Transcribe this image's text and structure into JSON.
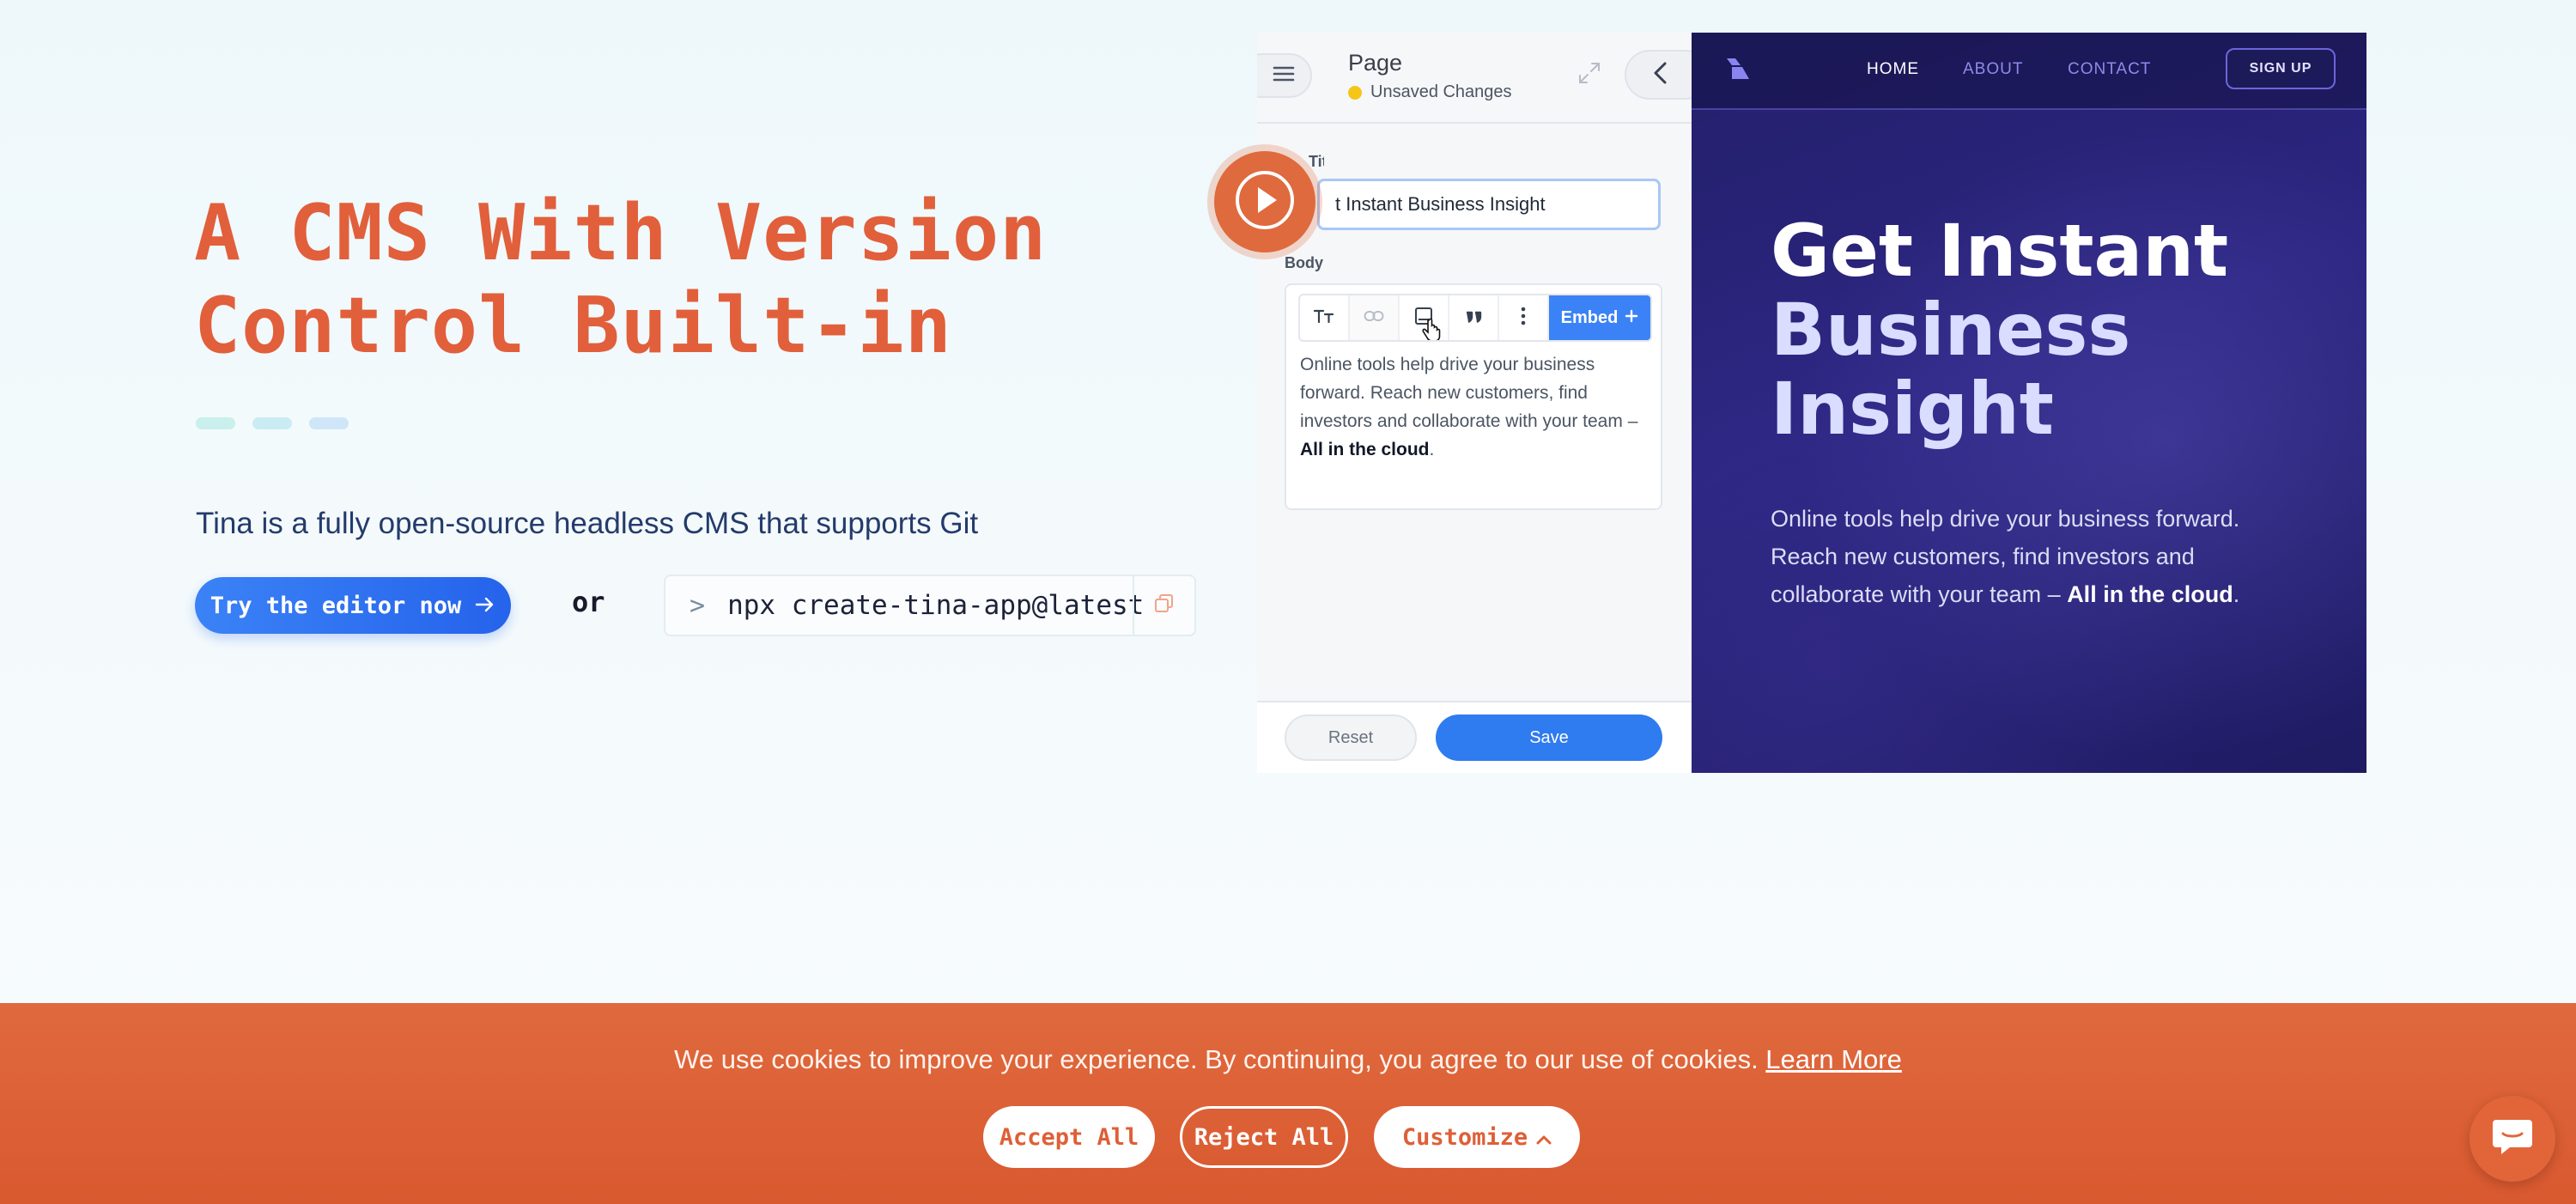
{
  "hero": {
    "title_line1": "A CMS With Version",
    "title_line2": "Control Built-in",
    "subtitle": "Tina is a fully open-source headless CMS that supports Git",
    "try_button": "Try the editor now",
    "or": "or",
    "command_prompt": ">",
    "command": "npx create-tina-app@latest",
    "colors": {
      "title": "#e15f3b",
      "dashes": [
        "#c9f0ec",
        "#c9ecf3",
        "#cfe6f8"
      ]
    }
  },
  "editor": {
    "title": "Page",
    "status": "Unsaved Changes",
    "title_label": "Title",
    "title_value": "t Instant Business Insight",
    "body_label": "Body",
    "embed_label": "Embed",
    "body_text": "Online tools help drive your business forward. Reach new customers, find investors and collaborate with your team – ",
    "body_bold": "All in the cloud",
    "body_end": ".",
    "reset": "Reset",
    "save": "Save"
  },
  "preview": {
    "nav": [
      "HOME",
      "ABOUT",
      "CONTACT"
    ],
    "signup": "SIGN UP",
    "heading_line1": "Get Instant",
    "heading_line2": "Business",
    "heading_line3": "Insight",
    "para": "Online tools help drive your business forward. Reach new customers, find investors and collaborate with your team – ",
    "para_bold": "All in the cloud",
    "para_end": "."
  },
  "cookie": {
    "text": "We use cookies to improve your experience. By continuing, you agree to our use of cookies. ",
    "learn_more": "Learn More",
    "accept": "Accept All",
    "reject": "Reject All",
    "customize": "Customize"
  }
}
